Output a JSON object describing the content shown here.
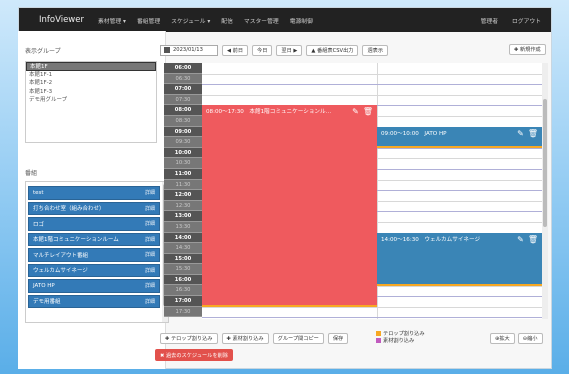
{
  "navbar": {
    "brand": "InfoViewer",
    "items": [
      "素材管理 ▾",
      "番組管理",
      "スケジュール ▾",
      "配信",
      "マスター管理",
      "電源制御"
    ],
    "right": [
      "管理者",
      "ログアウト"
    ]
  },
  "left": {
    "group_title": "表示グループ",
    "groups": [
      "本館1F",
      "本館1F-1",
      "本館1F-2",
      "本館1F-3",
      "デモ用グループ"
    ],
    "program_title": "番組",
    "programs": [
      {
        "label": "test",
        "detail": "詳細"
      },
      {
        "label": "打ち合わせ室（組み合わせ）",
        "detail": "詳細"
      },
      {
        "label": "ロゴ",
        "detail": "詳細"
      },
      {
        "label": "本館1階コミュニケーションルーム",
        "detail": "詳細"
      },
      {
        "label": "マルチレイアウト番組",
        "detail": "詳細"
      },
      {
        "label": "ウェルカムサイネージ",
        "detail": "詳細"
      },
      {
        "label": "JATO HP",
        "detail": "詳細"
      },
      {
        "label": "デモ用番組",
        "detail": "詳細"
      }
    ]
  },
  "toolbar": {
    "date": "2023/01/13",
    "prev": "◀ 前日",
    "today": "今日",
    "next": "翌日 ▶",
    "csv": "▲ 番組表CSV出力",
    "view": "週表示",
    "new": "✚ 新規作成"
  },
  "times": [
    "06:00",
    "06:30",
    "07:00",
    "07:30",
    "08:00",
    "08:30",
    "09:00",
    "09:30",
    "10:00",
    "10:30",
    "11:00",
    "11:30",
    "12:00",
    "12:30",
    "13:00",
    "13:30",
    "14:00",
    "14:30",
    "15:00",
    "15:30",
    "16:00",
    "16:30",
    "17:00",
    "17:30"
  ],
  "events": [
    {
      "label": "08:00〜17:30　本館1階コミュニケーションル…",
      "color": "#ef5a5e"
    },
    {
      "label": "09:00〜10:00　JATO HP",
      "color": "#3a85b6"
    },
    {
      "label": "14:00〜16:30　ウェルカムサイネージ",
      "color": "#3a85b6"
    }
  ],
  "bottom": {
    "tc_insert": "✚ テロップ割り込み",
    "mat_insert": "✚ 素材割り込み",
    "group_copy": "グループ間コピー",
    "save": "保存",
    "legend_tc": "テロップ割り込み",
    "legend_mat": "素材割り込み",
    "zoom_in": "拡大",
    "zoom_out": "縮小",
    "delete_past": "✖ 過去のスケジュールを削除"
  },
  "colors": {
    "legend_tc": "#f7a823",
    "legend_mat": "#c15bbf",
    "red": "#ef5a5e",
    "blue": "#3a85b6"
  }
}
